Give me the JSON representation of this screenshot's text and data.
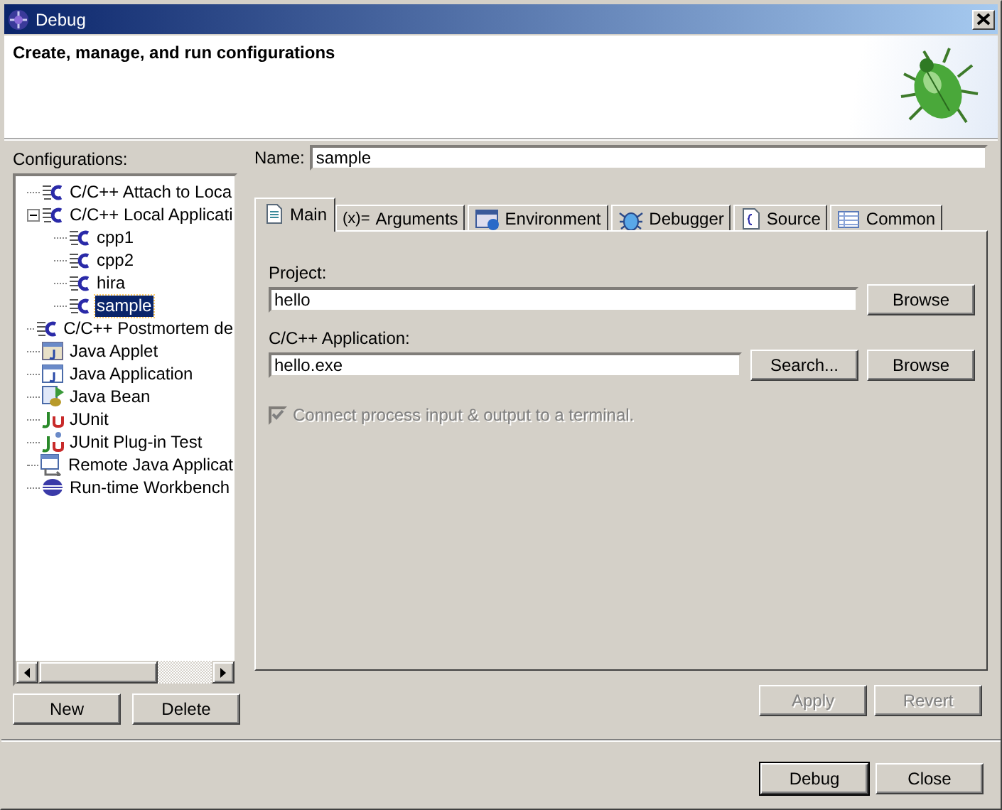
{
  "window": {
    "title": "Debug"
  },
  "header": {
    "title": "Create, manage, and run configurations"
  },
  "configurations": {
    "label": "Configurations:",
    "tree": [
      {
        "label": "C/C++ Attach to Loca",
        "kind": "cdt",
        "selected": false
      },
      {
        "label": "C/C++ Local Applicati",
        "kind": "cdt",
        "selected": false,
        "expanded": true,
        "children": [
          {
            "label": "cpp1",
            "kind": "cdt",
            "selected": false
          },
          {
            "label": "cpp2",
            "kind": "cdt",
            "selected": false
          },
          {
            "label": "hira",
            "kind": "cdt",
            "selected": false
          },
          {
            "label": "sample",
            "kind": "cdt",
            "selected": true
          }
        ]
      },
      {
        "label": "C/C++ Postmortem de",
        "kind": "cdt",
        "selected": false
      },
      {
        "label": "Java Applet",
        "kind": "applet",
        "selected": false
      },
      {
        "label": "Java Application",
        "kind": "javaapp",
        "selected": false
      },
      {
        "label": "Java Bean",
        "kind": "bean",
        "selected": false
      },
      {
        "label": "JUnit",
        "kind": "junit",
        "selected": false
      },
      {
        "label": "JUnit Plug-in Test",
        "kind": "junitplugin",
        "selected": false
      },
      {
        "label": "Remote Java Applicat",
        "kind": "remote",
        "selected": false
      },
      {
        "label": "Run-time Workbench",
        "kind": "workbench",
        "selected": false
      }
    ],
    "buttons": [
      {
        "label": "New",
        "disabled": false
      },
      {
        "label": "Delete",
        "disabled": false
      }
    ]
  },
  "name": {
    "label": "Name:",
    "value": "sample"
  },
  "tabs": [
    {
      "label": "Main",
      "kind": "document",
      "selected": true
    },
    {
      "label": "Arguments",
      "kind": "variables",
      "glyph": "(x)=",
      "selected": false
    },
    {
      "label": "Environment",
      "kind": "environment",
      "selected": false
    },
    {
      "label": "Debugger",
      "kind": "bug",
      "selected": false
    },
    {
      "label": "Source",
      "kind": "source",
      "selected": false
    },
    {
      "label": "Common",
      "kind": "table",
      "selected": false
    }
  ],
  "main": {
    "project": {
      "label": "Project:",
      "value": "hello",
      "buttons": [
        {
          "label": "Browse",
          "disabled": false
        }
      ]
    },
    "application": {
      "label": "C/C++ Application:",
      "value": "hello.exe",
      "buttons": [
        {
          "label": "Search...",
          "disabled": false
        },
        {
          "label": "Browse",
          "disabled": false
        }
      ]
    },
    "terminal": {
      "label": "Connect process input & output to a terminal.",
      "checked": true,
      "disabled": true
    }
  },
  "config_buttons": [
    {
      "label": "Apply",
      "disabled": true
    },
    {
      "label": "Revert",
      "disabled": true
    }
  ],
  "dialog_buttons": [
    {
      "label": "Debug",
      "disabled": false,
      "default": true
    },
    {
      "label": "Close",
      "disabled": false,
      "default": false
    }
  ]
}
